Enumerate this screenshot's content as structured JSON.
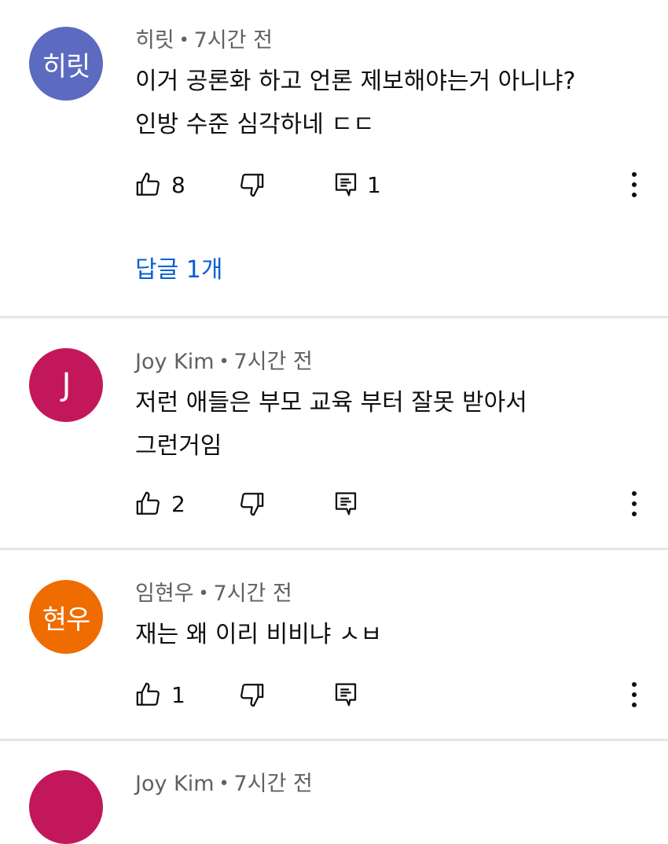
{
  "comments": [
    {
      "avatar_text": "히릿",
      "avatar_color": "#5c6bc0",
      "author": "히릿",
      "time": "7시간 전",
      "text": "이거 공론화 하고 언론 제보해야는거 아니냐?\n인방 수준 심각하네 ㄷㄷ",
      "likes": "8",
      "replies_count": "1",
      "replies_link": "답글 1개"
    },
    {
      "avatar_text": "J",
      "avatar_color": "#c2185b",
      "author": "Joy Kim",
      "time": "7시간 전",
      "text": "저런 애들은 부모 교육 부터 잘못 받아서\n그런거임",
      "likes": "2"
    },
    {
      "avatar_text": "현우",
      "avatar_color": "#ef6c00",
      "author": "임현우",
      "time": "7시간 전",
      "text": "재는 왜 이리 비비냐 ㅅㅂ",
      "likes": "1"
    },
    {
      "avatar_color": "#c2185b",
      "author": "Joy Kim",
      "time": "7시간 전"
    }
  ],
  "meta_separator": "•",
  "icons": {
    "like": "thumbs-up-icon",
    "dislike": "thumbs-down-icon",
    "reply": "comment-icon",
    "more": "more-vert-icon"
  }
}
